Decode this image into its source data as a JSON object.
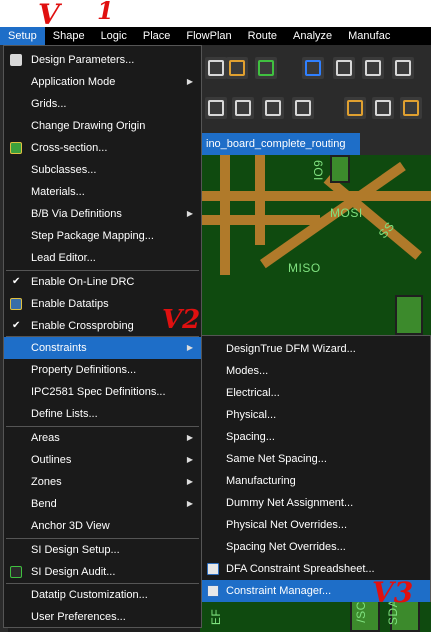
{
  "menubar": {
    "items": [
      "Setup",
      "Shape",
      "Logic",
      "Place",
      "FlowPlan",
      "Route",
      "Analyze",
      "Manufac"
    ],
    "active_index": 0
  },
  "document_tab": {
    "label": "ino_board_complete_routing"
  },
  "canvas": {
    "net_labels": [
      "MOSI",
      "MISO",
      "IO9",
      "SS",
      "/SC",
      "SDA",
      "EF"
    ]
  },
  "setup_menu": {
    "items": [
      {
        "label": "Design Parameters...",
        "icon": "design-params-icon"
      },
      {
        "label": "Application Mode",
        "submenu": true
      },
      {
        "label": "Grids..."
      },
      {
        "label": "Change Drawing Origin"
      },
      {
        "label": "Cross-section...",
        "icon": "cross-section-icon"
      },
      {
        "label": "Subclasses..."
      },
      {
        "label": "Materials..."
      },
      {
        "label": "B/B Via Definitions",
        "submenu": true
      },
      {
        "label": "Step Package Mapping..."
      },
      {
        "label": "Lead Editor..."
      },
      {
        "label": "Enable On-Line DRC",
        "checked": true
      },
      {
        "label": "Enable Datatips",
        "icon": "datatips-icon"
      },
      {
        "label": "Enable Crossprobing",
        "checked": true
      },
      {
        "label": "Constraints",
        "submenu": true,
        "highlighted": true
      },
      {
        "label": "Property Definitions..."
      },
      {
        "label": "IPC2581 Spec Definitions..."
      },
      {
        "label": "Define Lists..."
      },
      {
        "label": "Areas",
        "submenu": true
      },
      {
        "label": "Outlines",
        "submenu": true
      },
      {
        "label": "Zones",
        "submenu": true
      },
      {
        "label": "Bend",
        "submenu": true
      },
      {
        "label": "Anchor 3D View"
      },
      {
        "label": "SI Design Setup..."
      },
      {
        "label": "SI Design Audit...",
        "icon": "si-audit-icon"
      },
      {
        "label": "Datatip Customization..."
      },
      {
        "label": "User Preferences..."
      }
    ],
    "arrow_glyph": "▶",
    "check_glyph": "✔"
  },
  "constraints_submenu": {
    "items": [
      {
        "label": "DesignTrue DFM Wizard..."
      },
      {
        "label": "Modes..."
      },
      {
        "label": "Electrical..."
      },
      {
        "label": "Physical..."
      },
      {
        "label": "Spacing..."
      },
      {
        "label": "Same Net Spacing..."
      },
      {
        "label": "Manufacturing"
      },
      {
        "label": "Dummy Net Assignment..."
      },
      {
        "label": "Physical Net Overrides..."
      },
      {
        "label": "Spacing Net Overrides..."
      },
      {
        "label": "DFA Constraint Spreadsheet...",
        "icon": "dfa-spreadsheet-icon"
      },
      {
        "label": "Constraint Manager...",
        "icon": "constraint-manager-icon",
        "highlighted": true
      }
    ]
  },
  "annotations": {
    "v1": "V",
    "one": "1",
    "v2": "V2",
    "v3": "V3"
  },
  "colors": {
    "highlight": "#1e6ec8",
    "menu_bg": "#1a1a1a",
    "annotation": "#e01010",
    "pcb_green": "#0f4a0f",
    "track": "#b07a2a"
  }
}
